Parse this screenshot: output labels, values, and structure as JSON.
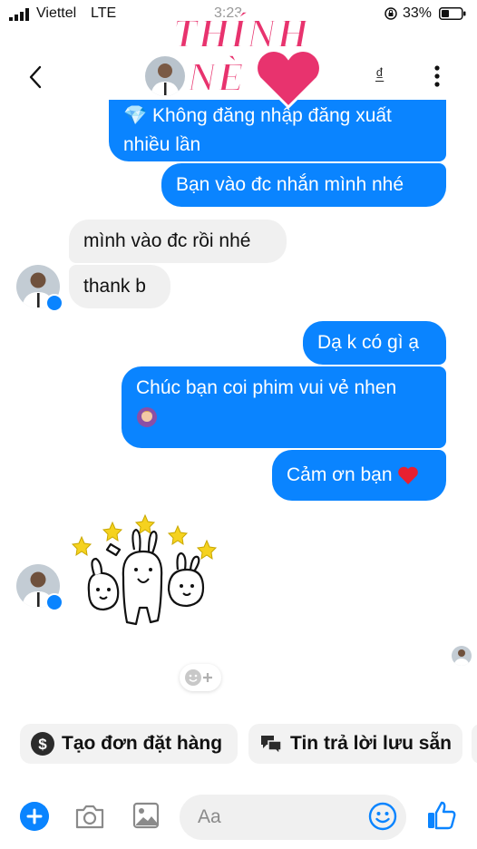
{
  "status_bar": {
    "carrier": "Viettel",
    "network": "LTE",
    "time": "3:23",
    "battery": "33%"
  },
  "header": {
    "currency_symbol": "₫"
  },
  "logo": {
    "line1": "THÍNH",
    "line2": "NÈ"
  },
  "messages": [
    {
      "from": "me",
      "text": "💎 Không đăng nhập đăng xuất nhiều lần"
    },
    {
      "from": "me",
      "text": "Bạn vào đc nhắn mình nhé"
    },
    {
      "from": "them",
      "text": "mình vào đc rồi nhé"
    },
    {
      "from": "them",
      "text": "thank b"
    },
    {
      "from": "me",
      "text": "Dạ k có gì ạ"
    },
    {
      "from": "me",
      "text": "Chúc bạn coi phim vui vẻ nhen"
    },
    {
      "from": "me",
      "text": "Cảm ơn bạn"
    }
  ],
  "quick_replies": [
    {
      "label": "Tạo đơn đặt hàng",
      "icon": "dollar-icon"
    },
    {
      "label": "Tin trả lời lưu sẵn",
      "icon": "saved-replies-icon"
    }
  ],
  "composer": {
    "placeholder": "Aa"
  },
  "colors": {
    "accent": "#0a84ff",
    "incoming_bubble": "#f0f0f0",
    "logo_pink": "#e8336e"
  }
}
